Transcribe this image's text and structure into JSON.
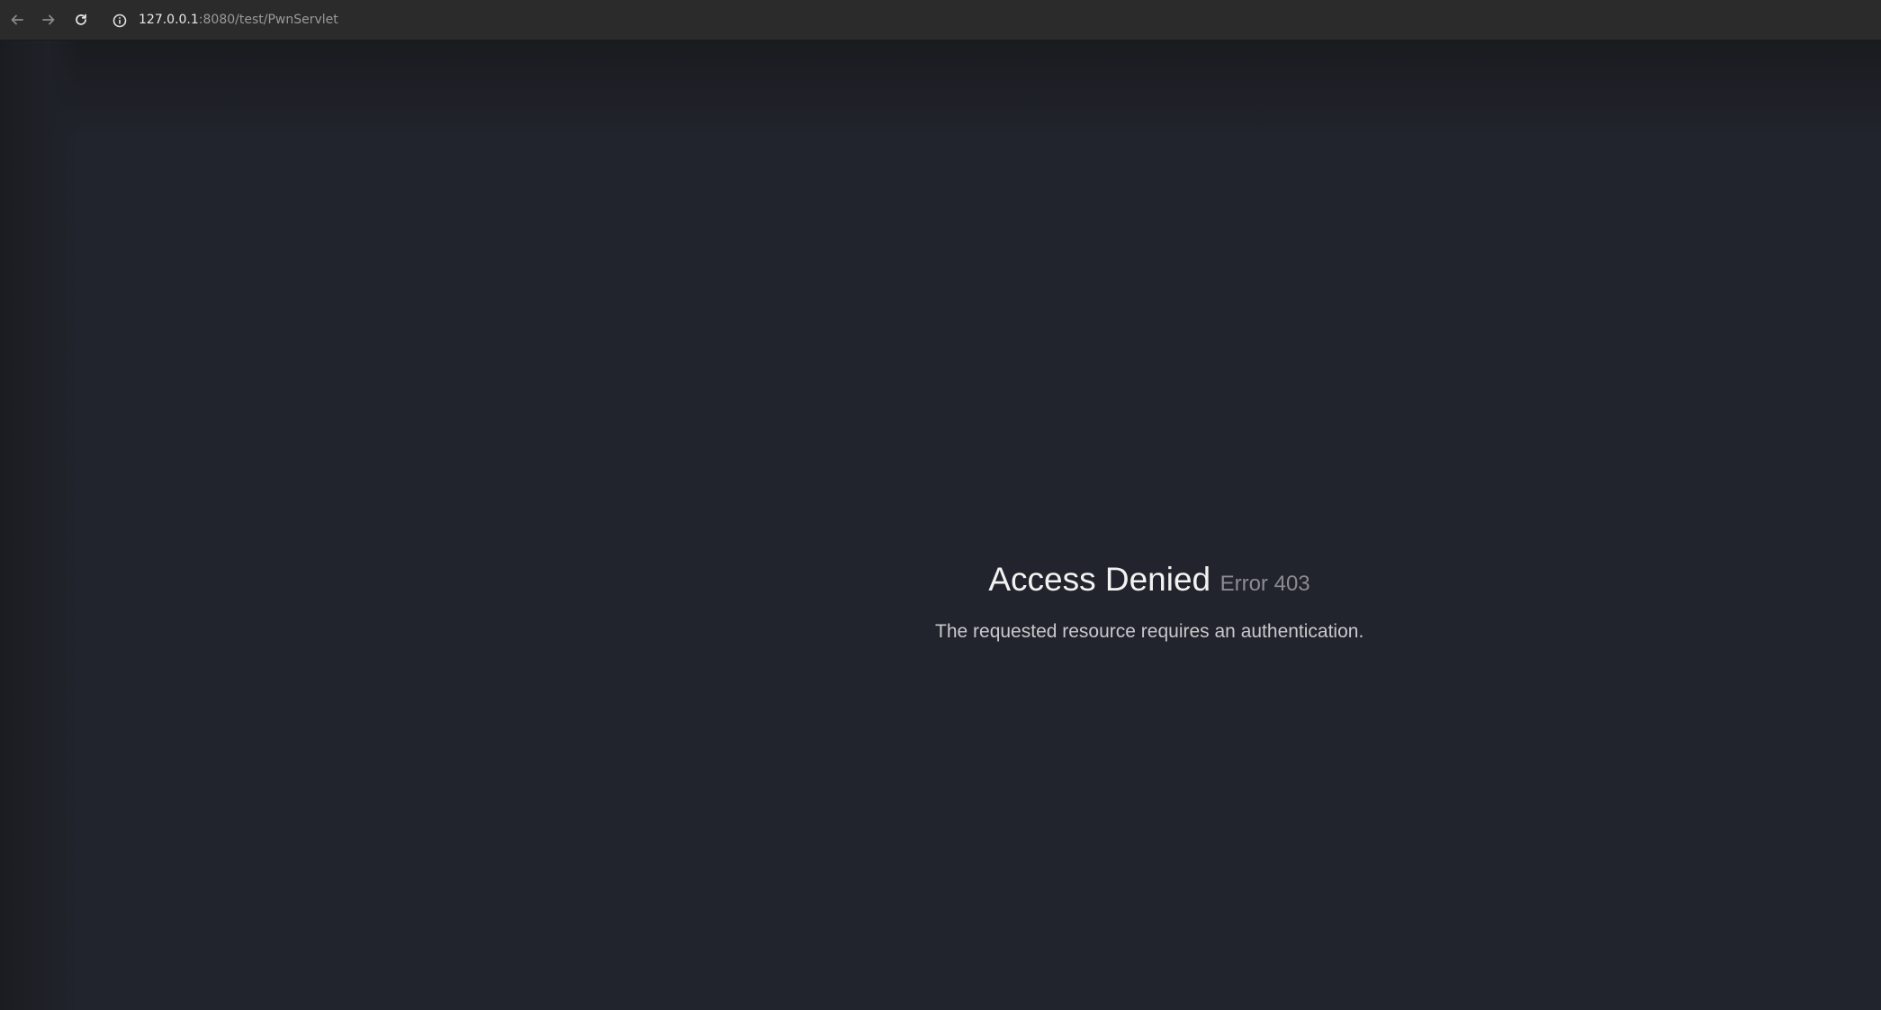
{
  "browser": {
    "url_host": "127.0.0.1",
    "url_path": ":8080/test/PwnServlet",
    "icons": {
      "back": "back-arrow-icon",
      "forward": "forward-arrow-icon",
      "reload": "reload-icon",
      "info": "info-icon"
    }
  },
  "page": {
    "title": "Access Denied",
    "error_code": "Error 403",
    "description": "The requested resource requires an authentication."
  },
  "colors": {
    "background": "#21242c",
    "toolbar": "#2b2b2b",
    "title": "#f2f2f2",
    "error_code": "#8a8c90",
    "description": "#c8c9cc"
  }
}
